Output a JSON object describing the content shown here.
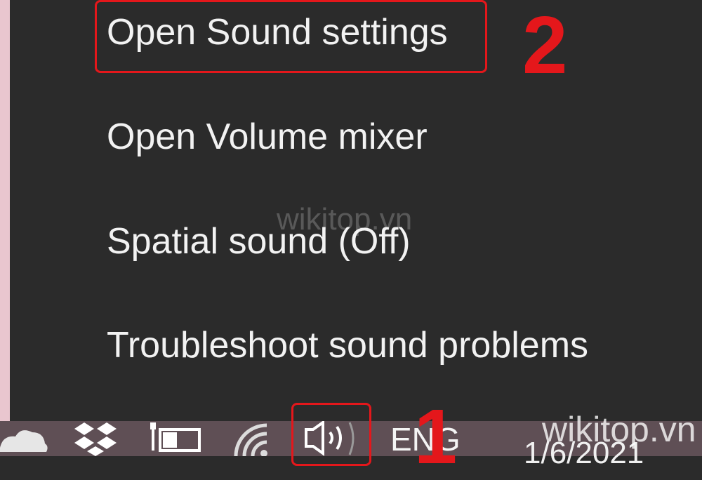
{
  "menu": {
    "items": [
      {
        "label": "Open Sound settings"
      },
      {
        "label": "Open Volume mixer"
      },
      {
        "label": "Spatial sound (Off)"
      },
      {
        "label": "Troubleshoot sound problems"
      }
    ]
  },
  "annotations": {
    "step1": "1",
    "step2": "2",
    "highlight_color": "#e4171b"
  },
  "taskbar": {
    "language": "ENG",
    "date_partial": "1/6/2021",
    "icons": [
      "onedrive-cloud-icon",
      "dropbox-icon",
      "battery-icon",
      "wifi-icon",
      "volume-icon"
    ]
  },
  "watermark": {
    "center": "wikitop.vn",
    "corner": "wikitop.vn"
  },
  "colors": {
    "menu_bg": "#2b2b2b",
    "menu_text": "#f2f2f2",
    "taskbar_bg": "#5f4f55"
  }
}
